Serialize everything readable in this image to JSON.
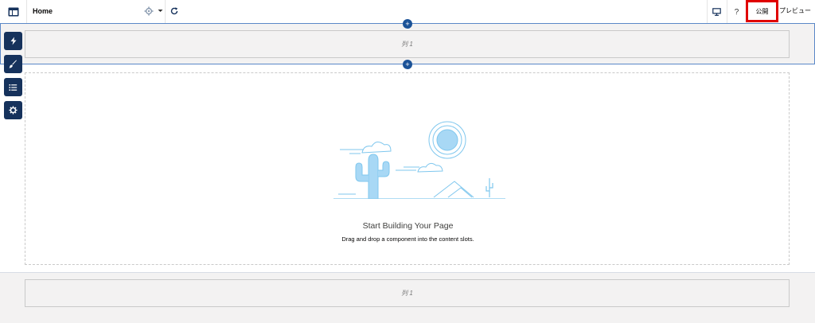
{
  "topbar": {
    "page_name": "Home",
    "publish_label": "公開",
    "preview_label": "プレビュー",
    "help_label": "?"
  },
  "regions": {
    "header_column_label": "列 1",
    "footer_column_label": "列 1"
  },
  "empty_state": {
    "title": "Start Building Your Page",
    "subtitle": "Drag and drop a component into the content slots."
  },
  "icons": {
    "app": "app-layout-icon",
    "settings": "gear-icon",
    "dropdown": "chevron-down-icon",
    "refresh": "refresh-icon",
    "desktop": "desktop-icon",
    "tools": [
      "lightning-icon",
      "brush-icon",
      "list-icon",
      "gear-icon"
    ]
  },
  "colors": {
    "accent": "#1b5297",
    "tool_bg": "#16325c",
    "highlight": "#e00000",
    "illustration": "#7fc7ee"
  }
}
